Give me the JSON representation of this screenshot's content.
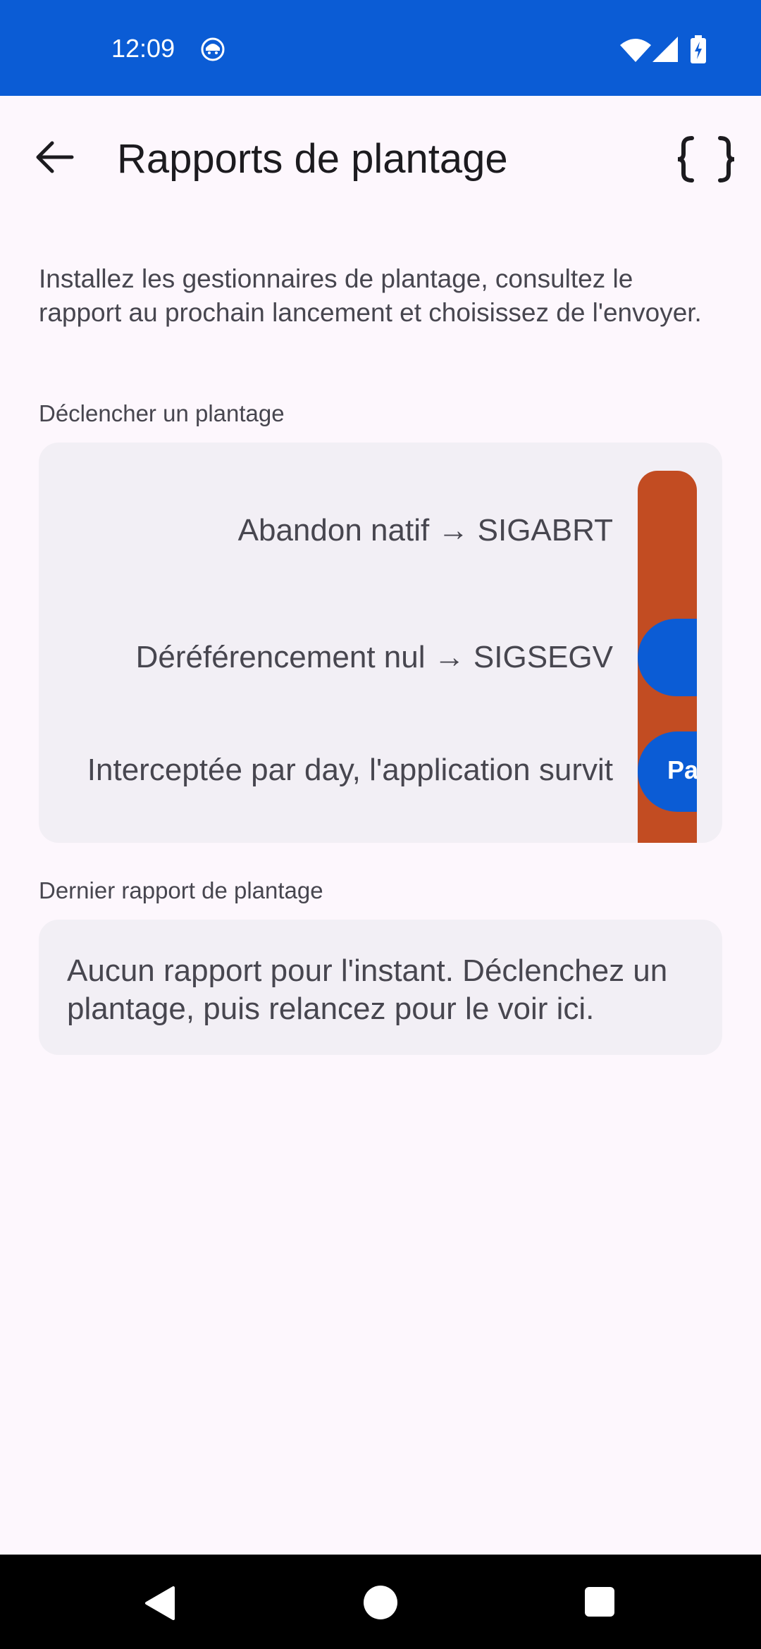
{
  "status_bar": {
    "time": "12:09",
    "icons": [
      "app-notification-icon",
      "wifi-icon",
      "signal-icon",
      "battery-charging-icon"
    ]
  },
  "top_bar": {
    "title": "Rapports de plantage",
    "back_icon": "arrow-back-icon",
    "action_icon": "code-braces-icon"
  },
  "intro_text": "Installez les gestionnaires de plantage, consultez le rapport au prochain lancement et choisissez de l'envoyer.",
  "trigger_section": {
    "label": "Déclencher un plantage",
    "rows": [
      {
        "label": "Abandon natif → SIGABRT"
      },
      {
        "label": "Déréférencement nul → SIGSEGV"
      },
      {
        "label": "Interceptée par day, l'application survit",
        "button_text_partial": "Pa"
      }
    ]
  },
  "report_section": {
    "label": "Dernier rapport de plantage",
    "text": "Aucun rapport pour l'instant. Déclenchez un plantage, puis relancez pour le voir ici."
  },
  "colors": {
    "status_bar": "#0B5CD5",
    "background": "#FDF7FD",
    "card": "#F2EFF5",
    "danger": "#C24C22",
    "primary": "#0B5CD5"
  },
  "nav_bar": {
    "icons": [
      "nav-back-icon",
      "nav-home-icon",
      "nav-recents-icon"
    ]
  }
}
